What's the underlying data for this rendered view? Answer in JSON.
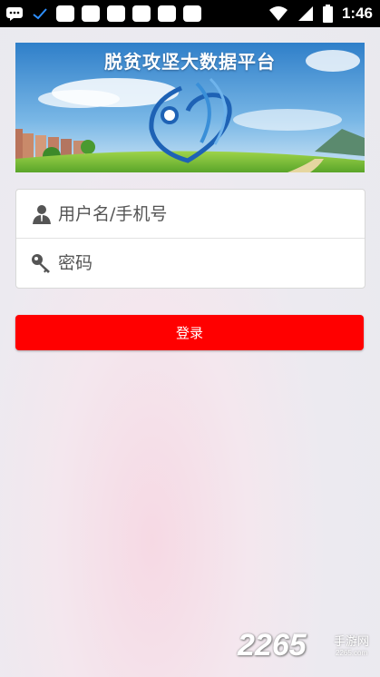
{
  "status_bar": {
    "time": "1:46",
    "left_icons": [
      "chat-icon",
      "check-icon",
      "notification-box",
      "notification-box",
      "notification-box",
      "notification-box",
      "notification-box",
      "notification-box"
    ],
    "right_icons": [
      "wifi-icon",
      "signal-icon",
      "battery-icon"
    ]
  },
  "banner": {
    "title": "脱贫攻坚大数据平台"
  },
  "login": {
    "username_placeholder": "用户名/手机号",
    "username_value": "",
    "password_placeholder": "密码",
    "password_value": "",
    "submit_label": "登录"
  },
  "colors": {
    "primary_button": "#ff0000",
    "status_bar": "#000000"
  },
  "watermark": {
    "number": "2265",
    "text": "手游网",
    "url": "2265.com"
  }
}
